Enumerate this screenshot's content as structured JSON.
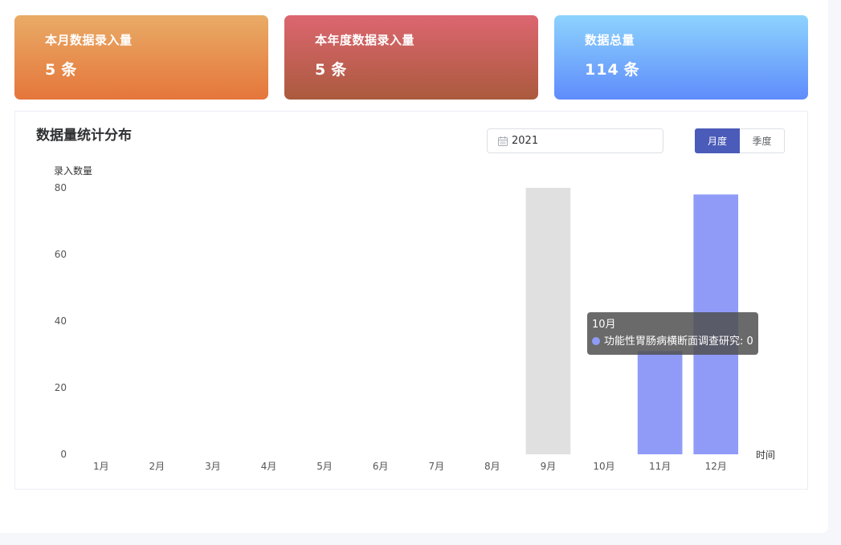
{
  "stats": {
    "month": {
      "label": "本月数据录入量",
      "value": "5",
      "unit": "条"
    },
    "year": {
      "label": "本年度数据录入量",
      "value": "5",
      "unit": "条"
    },
    "total": {
      "label": "数据总量",
      "value": "114",
      "unit": "条"
    }
  },
  "panel": {
    "title": "数据量统计分布",
    "year_value": "2021",
    "toggle": {
      "monthly": "月度",
      "quarterly": "季度",
      "active": "monthly"
    }
  },
  "colors": {
    "bar": "#8f9bf7",
    "highlight_bar": "#e0e0e0",
    "axis_text": "#555555"
  },
  "chart_data": {
    "type": "bar",
    "ylabel": "录入数量",
    "xlabel": "时间",
    "categories": [
      "1月",
      "2月",
      "3月",
      "4月",
      "5月",
      "6月",
      "7月",
      "8月",
      "9月",
      "10月",
      "11月",
      "12月"
    ],
    "series": [
      {
        "name": "功能性胃肠病横断面调查研究",
        "values": [
          0,
          0,
          0,
          0,
          0,
          0,
          0,
          0,
          0,
          0,
          31,
          78
        ]
      }
    ],
    "ylim": [
      0,
      80
    ],
    "yticks": [
      0,
      20,
      40,
      60,
      80
    ],
    "grid": false,
    "hover_index": 8
  },
  "tooltip": {
    "title": "10月",
    "series_name": "功能性胃肠病横断面调查研究",
    "value": "0"
  }
}
